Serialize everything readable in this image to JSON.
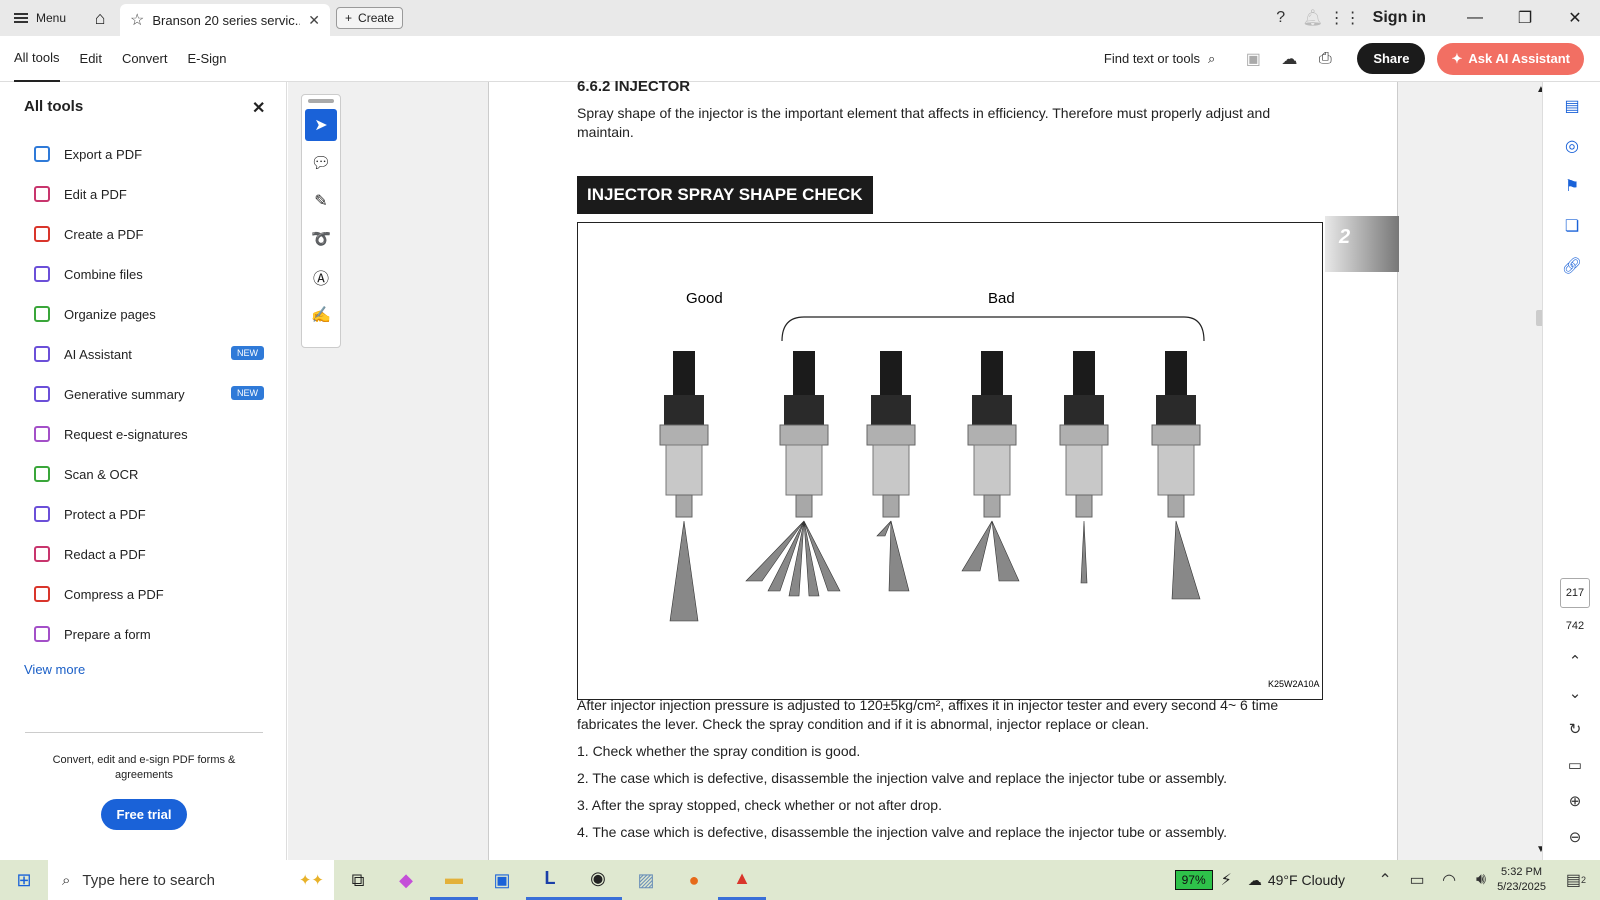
{
  "titlebar": {
    "menu_label": "Menu",
    "tab_title": "Branson 20 series servic...",
    "create_label": "Create",
    "sign_in": "Sign in"
  },
  "toolbar": {
    "tabs": [
      "All tools",
      "Edit",
      "Convert",
      "E-Sign"
    ],
    "find_label": "Find text or tools",
    "share_label": "Share",
    "ask_ai_label": "Ask AI Assistant"
  },
  "panel": {
    "title": "All tools",
    "tools": [
      {
        "label": "Export a PDF",
        "badge": ""
      },
      {
        "label": "Edit a PDF",
        "badge": ""
      },
      {
        "label": "Create a PDF",
        "badge": ""
      },
      {
        "label": "Combine files",
        "badge": ""
      },
      {
        "label": "Organize pages",
        "badge": ""
      },
      {
        "label": "AI Assistant",
        "badge": "NEW"
      },
      {
        "label": "Generative summary",
        "badge": "NEW"
      },
      {
        "label": "Request e-signatures",
        "badge": ""
      },
      {
        "label": "Scan & OCR",
        "badge": ""
      },
      {
        "label": "Protect a PDF",
        "badge": ""
      },
      {
        "label": "Redact a PDF",
        "badge": ""
      },
      {
        "label": "Compress a PDF",
        "badge": ""
      },
      {
        "label": "Prepare a form",
        "badge": ""
      }
    ],
    "view_more": "View more",
    "promo_text": "Convert, edit and e-sign PDF forms & agreements",
    "trial_label": "Free trial"
  },
  "document": {
    "section_heading": "6.6.2 INJECTOR",
    "intro": "Spray shape of the injector is the important element that affects in efficiency. Therefore must properly adjust and maintain.",
    "banner": "INJECTOR SPRAY SHAPE CHECK",
    "figure": {
      "good_label": "Good",
      "bad_label": "Bad",
      "code": "K25W2A10A"
    },
    "side_tab": "2",
    "para1": "After injector injection pressure is adjusted to 120±5kg/cm², affixes it in injector tester and every second 4~ 6 time fabricates the lever. Check the spray condition and if it is abnormal, injector replace or clean.",
    "items": [
      "1. Check whether the spray condition is good.",
      "2. The case which is defective, disassemble the injection valve and replace the injector tube or assembly.",
      "3. After the spray stopped, check whether or not after drop.",
      "4. The case which is defective, disassemble the injection valve and replace the injector tube or assembly."
    ]
  },
  "pager": {
    "current": "217",
    "total": "742"
  },
  "taskbar": {
    "search_placeholder": "Type here to search",
    "battery": "97%",
    "weather": "49°F  Cloudy",
    "time": "5:32 PM",
    "date": "5/23/2025",
    "notif_count": "2"
  }
}
